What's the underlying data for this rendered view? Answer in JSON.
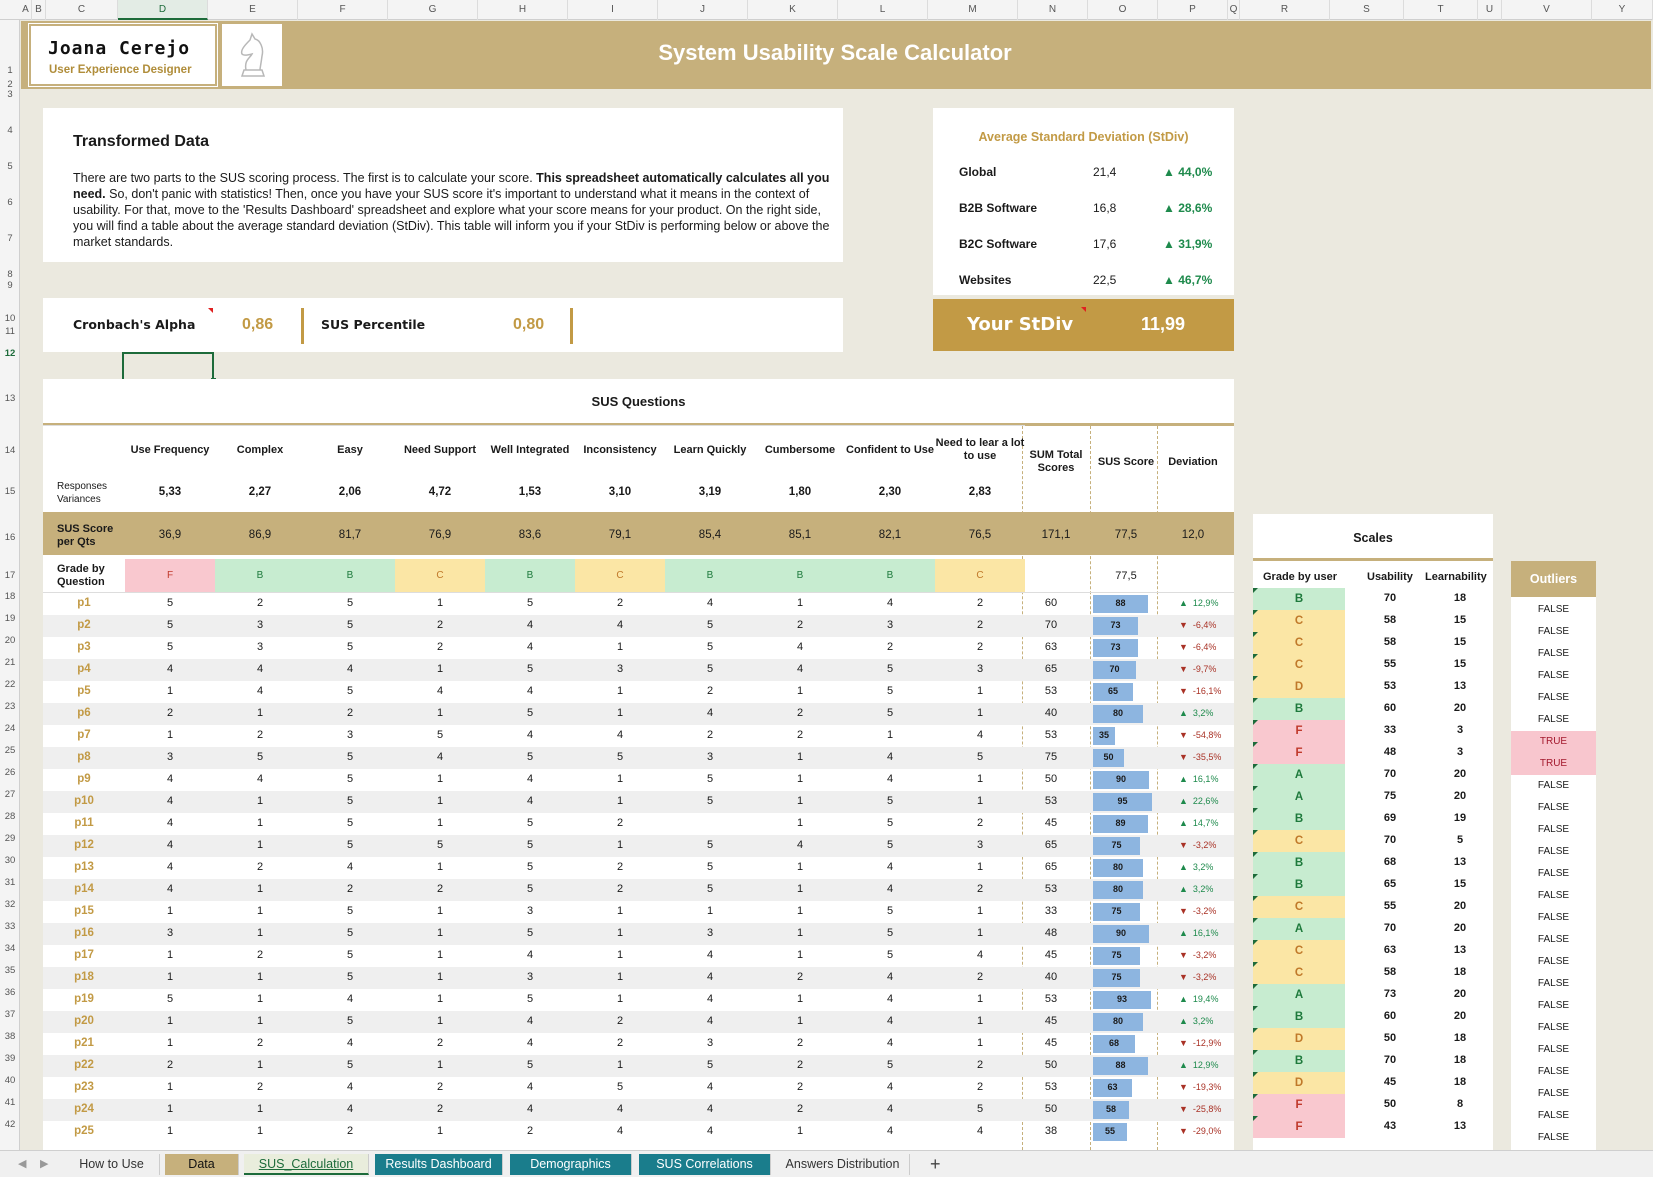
{
  "columns": [
    "A",
    "B",
    "C",
    "D",
    "E",
    "F",
    "G",
    "H",
    "I",
    "J",
    "K",
    "L",
    "M",
    "N",
    "O",
    "P",
    "Q",
    "R",
    "S",
    "T",
    "U",
    "V",
    "Y"
  ],
  "rows": [
    "1",
    "2",
    "3",
    "4",
    "5",
    "6",
    "7",
    "8",
    "9",
    "10",
    "11",
    "12",
    "13",
    "14",
    "15",
    "16",
    "17",
    "18",
    "19",
    "20",
    "21",
    "22",
    "23",
    "24",
    "25",
    "26",
    "27",
    "28",
    "29",
    "30",
    "31",
    "32",
    "33",
    "34",
    "35",
    "36",
    "37",
    "38",
    "39",
    "40",
    "41",
    "42"
  ],
  "header": {
    "name": "Joana Cerejo",
    "role": "User Experience Designer",
    "title": "System Usability Scale Calculator"
  },
  "intro": {
    "heading": "Transformed Data",
    "text_a": "There are two parts to the SUS scoring process. The first is to calculate your score. ",
    "text_bold": "This spreadsheet automatically calculates all you need.",
    "text_b": " So, don't panic with statistics! Then, once you have your SUS score it's important to understand what it means in the context of usability. For that, move to the 'Results Dashboard' spreadsheet and explore what your score means for your product. On the right side, you will find a table about the average standard deviation (StDiv). This table will inform you if your StDiv is performing below or above the market standards."
  },
  "metrics": {
    "alpha_label": "Cronbach's Alpha",
    "alpha_value": "0,86",
    "percentile_label": "SUS Percentile",
    "percentile_value": "0,80"
  },
  "stdiv": {
    "title": "Average Standard Deviation (StDiv)",
    "rows": [
      {
        "label": "Global",
        "value": "21,4",
        "change": "44,0%"
      },
      {
        "label": "B2B Software",
        "value": "16,8",
        "change": "28,6%"
      },
      {
        "label": "B2C Software",
        "value": "17,6",
        "change": "31,9%"
      },
      {
        "label": "Websites",
        "value": "22,5",
        "change": "46,7%"
      }
    ],
    "yours_label": "Your StDiv",
    "yours_value": "11,99"
  },
  "sus": {
    "title": "SUS Questions",
    "questions": [
      "Use Frequency",
      "Complex",
      "Easy",
      "Need Support",
      "Well Integrated",
      "Inconsistency",
      "Learn Quickly",
      "Cumbersome",
      "Confident to Use",
      "Need to lear a lot to use"
    ],
    "col_total": "SUM Total Scores",
    "col_score": "SUS Score",
    "col_dev": "Deviation",
    "variances_label": "Responses Variances",
    "variances": [
      "5,33",
      "2,27",
      "2,06",
      "4,72",
      "1,53",
      "3,10",
      "3,19",
      "1,80",
      "2,30",
      "2,83"
    ],
    "score_label": "SUS Score per Qts",
    "scores": [
      "36,9",
      "86,9",
      "81,7",
      "76,9",
      "83,6",
      "79,1",
      "85,4",
      "85,1",
      "82,1",
      "76,5"
    ],
    "score_total": "171,1",
    "score_sus": "77,5",
    "score_dev": "12,0",
    "grade_label": "Grade by Question",
    "grades": [
      "F",
      "B",
      "B",
      "C",
      "B",
      "C",
      "B",
      "B",
      "B",
      "C"
    ],
    "grade_sus": "77,5",
    "participants": [
      {
        "name": "p1",
        "vals": [
          "5",
          "2",
          "5",
          "1",
          "5",
          "2",
          "4",
          "1",
          "4",
          "2"
        ],
        "total": "60",
        "sus": 88,
        "dev": "12,9%",
        "up": true
      },
      {
        "name": "p2",
        "vals": [
          "5",
          "3",
          "5",
          "2",
          "4",
          "4",
          "5",
          "2",
          "3",
          "2"
        ],
        "total": "70",
        "sus": 73,
        "dev": "-6,4%",
        "up": false
      },
      {
        "name": "p3",
        "vals": [
          "5",
          "3",
          "5",
          "2",
          "4",
          "1",
          "5",
          "4",
          "2",
          "2"
        ],
        "total": "63",
        "sus": 73,
        "dev": "-6,4%",
        "up": false
      },
      {
        "name": "p4",
        "vals": [
          "4",
          "4",
          "4",
          "1",
          "5",
          "3",
          "5",
          "4",
          "5",
          "3"
        ],
        "total": "65",
        "sus": 70,
        "dev": "-9,7%",
        "up": false
      },
      {
        "name": "p5",
        "vals": [
          "1",
          "4",
          "5",
          "4",
          "4",
          "1",
          "2",
          "1",
          "5",
          "1"
        ],
        "total": "53",
        "sus": 65,
        "dev": "-16,1%",
        "up": false
      },
      {
        "name": "p6",
        "vals": [
          "2",
          "1",
          "2",
          "1",
          "5",
          "1",
          "4",
          "2",
          "5",
          "1"
        ],
        "total": "40",
        "sus": 80,
        "dev": "3,2%",
        "up": true
      },
      {
        "name": "p7",
        "vals": [
          "1",
          "2",
          "3",
          "5",
          "4",
          "4",
          "2",
          "2",
          "1",
          "4"
        ],
        "total": "53",
        "sus": 35,
        "dev": "-54,8%",
        "up": false
      },
      {
        "name": "p8",
        "vals": [
          "3",
          "5",
          "5",
          "4",
          "5",
          "5",
          "3",
          "1",
          "4",
          "5"
        ],
        "total": "75",
        "sus": 50,
        "dev": "-35,5%",
        "up": false
      },
      {
        "name": "p9",
        "vals": [
          "4",
          "4",
          "5",
          "1",
          "4",
          "1",
          "5",
          "1",
          "4",
          "1"
        ],
        "total": "50",
        "sus": 90,
        "dev": "16,1%",
        "up": true
      },
      {
        "name": "p10",
        "vals": [
          "4",
          "1",
          "5",
          "1",
          "4",
          "1",
          "5",
          "1",
          "5",
          "1"
        ],
        "total": "53",
        "sus": 95,
        "dev": "22,6%",
        "up": true
      },
      {
        "name": "p11",
        "vals": [
          "4",
          "1",
          "5",
          "1",
          "5",
          "2",
          "",
          "1",
          "5",
          "2"
        ],
        "total": "45",
        "sus": 89,
        "dev": "14,7%",
        "up": true
      },
      {
        "name": "p12",
        "vals": [
          "4",
          "1",
          "5",
          "5",
          "5",
          "1",
          "5",
          "4",
          "5",
          "3"
        ],
        "total": "65",
        "sus": 75,
        "dev": "-3,2%",
        "up": false
      },
      {
        "name": "p13",
        "vals": [
          "4",
          "2",
          "4",
          "1",
          "5",
          "2",
          "5",
          "1",
          "4",
          "1"
        ],
        "total": "65",
        "sus": 80,
        "dev": "3,2%",
        "up": true
      },
      {
        "name": "p14",
        "vals": [
          "4",
          "1",
          "2",
          "2",
          "5",
          "2",
          "5",
          "1",
          "4",
          "2"
        ],
        "total": "53",
        "sus": 80,
        "dev": "3,2%",
        "up": true
      },
      {
        "name": "p15",
        "vals": [
          "1",
          "1",
          "5",
          "1",
          "3",
          "1",
          "1",
          "1",
          "5",
          "1"
        ],
        "total": "33",
        "sus": 75,
        "dev": "-3,2%",
        "up": false
      },
      {
        "name": "p16",
        "vals": [
          "3",
          "1",
          "5",
          "1",
          "5",
          "1",
          "3",
          "1",
          "5",
          "1"
        ],
        "total": "48",
        "sus": 90,
        "dev": "16,1%",
        "up": true
      },
      {
        "name": "p17",
        "vals": [
          "1",
          "2",
          "5",
          "1",
          "4",
          "1",
          "4",
          "1",
          "5",
          "4"
        ],
        "total": "45",
        "sus": 75,
        "dev": "-3,2%",
        "up": false
      },
      {
        "name": "p18",
        "vals": [
          "1",
          "1",
          "5",
          "1",
          "3",
          "1",
          "4",
          "2",
          "4",
          "2"
        ],
        "total": "40",
        "sus": 75,
        "dev": "-3,2%",
        "up": false
      },
      {
        "name": "p19",
        "vals": [
          "5",
          "1",
          "4",
          "1",
          "5",
          "1",
          "4",
          "1",
          "4",
          "1"
        ],
        "total": "53",
        "sus": 93,
        "dev": "19,4%",
        "up": true
      },
      {
        "name": "p20",
        "vals": [
          "1",
          "1",
          "5",
          "1",
          "4",
          "2",
          "4",
          "1",
          "4",
          "1"
        ],
        "total": "45",
        "sus": 80,
        "dev": "3,2%",
        "up": true
      },
      {
        "name": "p21",
        "vals": [
          "1",
          "2",
          "4",
          "2",
          "4",
          "2",
          "3",
          "2",
          "4",
          "1"
        ],
        "total": "45",
        "sus": 68,
        "dev": "-12,9%",
        "up": false
      },
      {
        "name": "p22",
        "vals": [
          "2",
          "1",
          "5",
          "1",
          "5",
          "1",
          "5",
          "2",
          "5",
          "2"
        ],
        "total": "50",
        "sus": 88,
        "dev": "12,9%",
        "up": true
      },
      {
        "name": "p23",
        "vals": [
          "1",
          "2",
          "4",
          "2",
          "4",
          "5",
          "4",
          "2",
          "4",
          "2"
        ],
        "total": "53",
        "sus": 63,
        "dev": "-19,3%",
        "up": false
      },
      {
        "name": "p24",
        "vals": [
          "1",
          "1",
          "4",
          "2",
          "4",
          "4",
          "4",
          "2",
          "4",
          "5"
        ],
        "total": "50",
        "sus": 58,
        "dev": "-25,8%",
        "up": false
      },
      {
        "name": "p25",
        "vals": [
          "1",
          "1",
          "2",
          "1",
          "2",
          "4",
          "4",
          "1",
          "4",
          "4"
        ],
        "total": "38",
        "sus": 55,
        "dev": "-29,0%",
        "up": false
      }
    ]
  },
  "scales": {
    "title": "Scales",
    "col_grade": "Grade by user",
    "col_usability": "Usability",
    "col_learnability": "Learnability",
    "rows": [
      {
        "g": "B",
        "u": "70",
        "l": "18"
      },
      {
        "g": "C",
        "u": "58",
        "l": "15"
      },
      {
        "g": "C",
        "u": "58",
        "l": "15"
      },
      {
        "g": "C",
        "u": "55",
        "l": "15"
      },
      {
        "g": "D",
        "u": "53",
        "l": "13"
      },
      {
        "g": "B",
        "u": "60",
        "l": "20"
      },
      {
        "g": "F",
        "u": "33",
        "l": "3"
      },
      {
        "g": "F",
        "u": "48",
        "l": "3"
      },
      {
        "g": "A",
        "u": "70",
        "l": "20"
      },
      {
        "g": "A",
        "u": "75",
        "l": "20"
      },
      {
        "g": "B",
        "u": "69",
        "l": "19"
      },
      {
        "g": "C",
        "u": "70",
        "l": "5"
      },
      {
        "g": "B",
        "u": "68",
        "l": "13"
      },
      {
        "g": "B",
        "u": "65",
        "l": "15"
      },
      {
        "g": "C",
        "u": "55",
        "l": "20"
      },
      {
        "g": "A",
        "u": "70",
        "l": "20"
      },
      {
        "g": "C",
        "u": "63",
        "l": "13"
      },
      {
        "g": "C",
        "u": "58",
        "l": "18"
      },
      {
        "g": "A",
        "u": "73",
        "l": "20"
      },
      {
        "g": "B",
        "u": "60",
        "l": "20"
      },
      {
        "g": "D",
        "u": "50",
        "l": "18"
      },
      {
        "g": "B",
        "u": "70",
        "l": "18"
      },
      {
        "g": "D",
        "u": "45",
        "l": "18"
      },
      {
        "g": "F",
        "u": "50",
        "l": "8"
      },
      {
        "g": "F",
        "u": "43",
        "l": "13"
      }
    ]
  },
  "outliers": {
    "title": "Outliers",
    "values": [
      "FALSE",
      "FALSE",
      "FALSE",
      "FALSE",
      "FALSE",
      "FALSE",
      "TRUE",
      "TRUE",
      "FALSE",
      "FALSE",
      "FALSE",
      "FALSE",
      "FALSE",
      "FALSE",
      "FALSE",
      "FALSE",
      "FALSE",
      "FALSE",
      "FALSE",
      "FALSE",
      "FALSE",
      "FALSE",
      "FALSE",
      "FALSE",
      "FALSE"
    ]
  },
  "grade_colors": {
    "A": "#c7ecd0",
    "B": "#c7ecd0",
    "C": "#fbe6a5",
    "D": "#fbe6a5",
    "F": "#f9c8cf"
  },
  "grade_text": {
    "A": "#1e7a3c",
    "B": "#1e7a3c",
    "C": "#c0792a",
    "D": "#c0792a",
    "F": "#c0392b"
  },
  "tabs": [
    "How to Use",
    "Data",
    "SUS_Calculation",
    "Results Dashboard",
    "Demographics",
    "SUS Correlations",
    "Answers Distribution"
  ]
}
